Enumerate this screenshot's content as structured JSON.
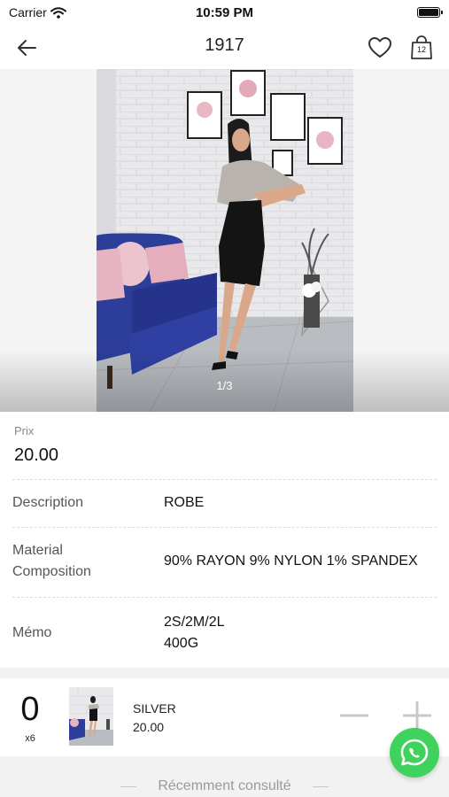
{
  "status_bar": {
    "carrier": "Carrier",
    "time": "10:59 PM"
  },
  "nav": {
    "title": "1917",
    "cart_count": "12"
  },
  "gallery": {
    "pager": "1/3"
  },
  "price": {
    "label": "Prix",
    "value": "20.00"
  },
  "attributes": [
    {
      "key": "Description",
      "value": "ROBE"
    },
    {
      "key_lines": [
        "Material",
        "Composition"
      ],
      "value": "90% RAYON 9% NYLON 1% SPANDEX"
    },
    {
      "key": "Mémo",
      "value_lines": [
        "2S/2M/2L",
        "400G"
      ]
    }
  ],
  "cart": {
    "quantity": "0",
    "multiplier": "x6",
    "variant": "SILVER",
    "price": "20.00"
  },
  "recent": {
    "title": "Récemment consulté"
  },
  "icons": {
    "back": "arrow-left-icon",
    "favorite": "heart-icon",
    "cart": "shopping-bag-icon",
    "wifi": "wifi-icon",
    "battery": "battery-icon",
    "minus": "minus-icon",
    "plus": "plus-icon",
    "whatsapp": "whatsapp-icon"
  },
  "colors": {
    "whatsapp_green": "#3fd35d",
    "dress_black": "#141414",
    "sofa_blue": "#2c3d9a",
    "cushion_pink": "#e7b5c2"
  }
}
